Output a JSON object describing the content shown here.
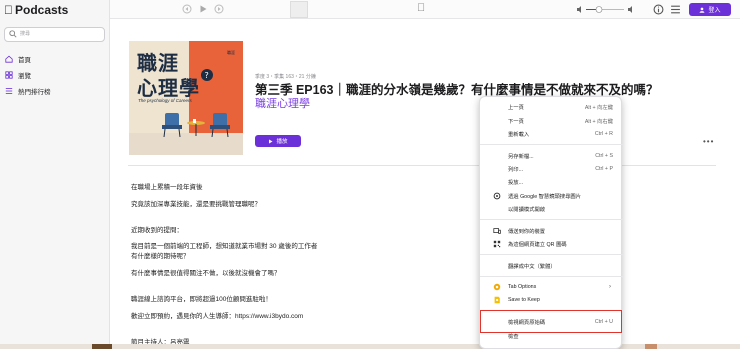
{
  "sidebar": {
    "brand": "Podcasts",
    "search_placeholder": "搜尋",
    "items": [
      {
        "label": "首頁",
        "icon": "home-icon"
      },
      {
        "label": "瀏覽",
        "icon": "grid-icon"
      },
      {
        "label": "熱門排行榜",
        "icon": "list-icon"
      }
    ]
  },
  "topbar": {
    "login_label": "登入"
  },
  "episode": {
    "meta": "季度 3・季集 163・21 分鐘",
    "title": "第三季 EP163｜職涯的分水嶺是幾歲？有什麼事情是不做就來不及的嗎？",
    "show_name": "職涯心理學",
    "play_label": "播放",
    "cover": {
      "title_line1": "職涯",
      "title_line2": "心理學",
      "subtitle": "The psychology of Careers",
      "logo": "職涯"
    }
  },
  "description": [
    "在職場上累積一段年資後",
    "究竟該加深專業技能，還是要挑戰管理職呢？",
    "近期收到的提問：",
    "我目前是一個前端的工程師，想知道就業市場對 30 歲後的工作者",
    "有什麼樣的期待呢？",
    "有什麼事情是很值得關注不做，以後就沒機會了嗎？",
    "職涯線上諮詢平台，即將超過100位顧問進駐啦！",
    "歡迎立即預約，遇見你的人生導師：https://www.i3bydo.com",
    "節目主持人：呂亮震"
  ],
  "context_menu": {
    "items": [
      {
        "label": "上一頁",
        "shortcut": "Alt + 向左鍵"
      },
      {
        "label": "下一頁",
        "shortcut": "Alt + 向右鍵"
      },
      {
        "label": "重新載入",
        "shortcut": "Ctrl + R"
      },
      {
        "label": "另存新檔...",
        "shortcut": "Ctrl + S"
      },
      {
        "label": "列印...",
        "shortcut": "Ctrl + P"
      },
      {
        "label": "投放...",
        "shortcut": ""
      },
      {
        "label": "透過 Google 智慧鏡頭搜尋圖片",
        "shortcut": ""
      },
      {
        "label": "以閱讀模式開啟",
        "shortcut": ""
      },
      {
        "label": "傳送到你的裝置",
        "shortcut": ""
      },
      {
        "label": "為這個網頁建立 QR 圖碼",
        "shortcut": ""
      },
      {
        "label": "翻譯成中文（繁體）",
        "shortcut": ""
      },
      {
        "label": "Tab Options",
        "shortcut": ""
      },
      {
        "label": "Save to Keep",
        "shortcut": ""
      },
      {
        "label": "檢視網頁原始碼",
        "shortcut": "Ctrl + U"
      },
      {
        "label": "檢查",
        "shortcut": ""
      }
    ]
  },
  "colors": {
    "accent": "#6c30d8",
    "highlight": "#e0342d"
  }
}
